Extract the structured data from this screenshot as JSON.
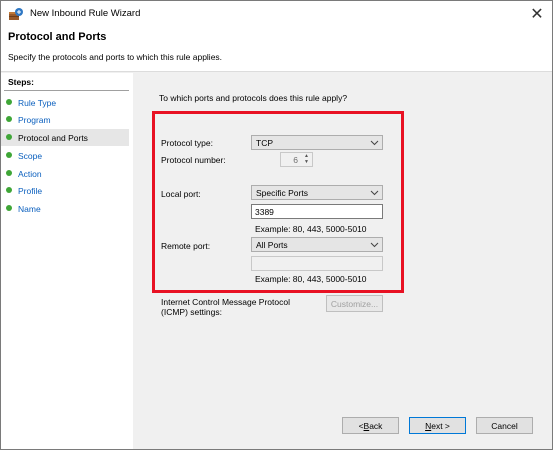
{
  "window": {
    "title": "New Inbound Rule Wizard",
    "close_glyph": "✕"
  },
  "header": {
    "title": "Protocol and Ports",
    "subtitle": "Specify the protocols and ports to which this rule applies."
  },
  "steps": {
    "heading": "Steps:",
    "items": [
      {
        "label": "Rule Type",
        "active": false
      },
      {
        "label": "Program",
        "active": false
      },
      {
        "label": "Protocol and Ports",
        "active": true
      },
      {
        "label": "Scope",
        "active": false
      },
      {
        "label": "Action",
        "active": false
      },
      {
        "label": "Profile",
        "active": false
      },
      {
        "label": "Name",
        "active": false
      }
    ]
  },
  "main": {
    "question": "To which ports and protocols does this rule apply?",
    "protocol_type": {
      "label": "Protocol type:",
      "value": "TCP"
    },
    "protocol_number": {
      "label": "Protocol number:",
      "value": "6"
    },
    "local_port": {
      "label": "Local port:",
      "value": "Specific Ports",
      "text": "3389",
      "example": "Example: 80, 443, 5000-5010"
    },
    "remote_port": {
      "label": "Remote port:",
      "value": "All Ports",
      "text": "",
      "example": "Example: 80, 443, 5000-5010"
    },
    "icmp": {
      "label_line1": "Internet Control Message Protocol",
      "label_line2": "(ICMP) settings:",
      "button": "Customize..."
    }
  },
  "footer": {
    "back_prefix": "< ",
    "back_underline": "B",
    "back_rest": "ack",
    "next_underline": "N",
    "next_rest": "ext >",
    "cancel": "Cancel"
  },
  "colors": {
    "highlight": "#e81123",
    "step_dot": "#3fa637",
    "link": "#0a5fbe"
  }
}
